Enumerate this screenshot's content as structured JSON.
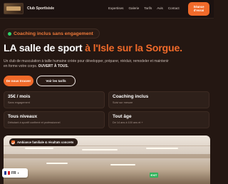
{
  "header": {
    "brand": "Club Sportlsisle",
    "nav": [
      "Expertises",
      "Galerie",
      "Tarifs",
      "Avis",
      "Contact"
    ],
    "cta_line1": "Séance",
    "cta_line2": "d'essai"
  },
  "hero": {
    "badge": "Coaching inclus sans engagement",
    "title_main": "LA salle de sport ",
    "title_accent": "à l'Isle sur la Sorgue.",
    "desc_main": "Un club de musculation à taille humaine créée pour développer, préparer, rééduir, remodeler et maintenir en forme votre corps. ",
    "desc_bold": "OUVERT À TOUS.",
    "btn_primary": "De nous trouver",
    "btn_secondary": "Voir les tarifs"
  },
  "features": [
    {
      "title": "35€ / mois",
      "sub": "Sans engagement"
    },
    {
      "title": "Coaching inclus",
      "sub": "Suivi sur mesure"
    },
    {
      "title": "Tous niveaux",
      "sub": "Débutant à sportif confirmé et professionnel"
    },
    {
      "title": "Tout âge",
      "sub": "De 14 ans à 100 ans et +"
    }
  ],
  "photo": {
    "badge": "Ambiance familiale & résultats concrets",
    "exit_sign": "EXIT"
  },
  "language": {
    "code": "FR",
    "flag_colors": [
      "#1f3c96",
      "#ffffff",
      "#d8232a"
    ]
  },
  "colors": {
    "accent": "#f06a2a",
    "background": "#241712",
    "badge_dot": "#2fd36a"
  }
}
